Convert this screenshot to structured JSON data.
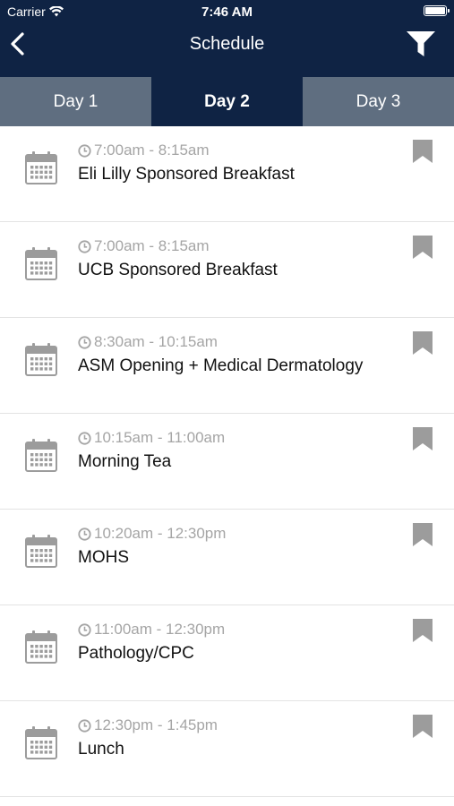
{
  "status_bar": {
    "carrier": "Carrier",
    "time": "7:46 AM"
  },
  "nav": {
    "title": "Schedule",
    "back_icon": "chevron-left-icon",
    "filter_icon": "filter-icon"
  },
  "tabs": [
    {
      "label": "Day 1",
      "active": false
    },
    {
      "label": "Day 2",
      "active": true
    },
    {
      "label": "Day 3",
      "active": false
    }
  ],
  "colors": {
    "header_bg": "#0f2344",
    "tab_inactive_bg": "#5f6e80",
    "time_text": "#a5a5a5",
    "icon_gray": "#9c9c9c"
  },
  "events": [
    {
      "time": "7:00am - 8:15am",
      "title": "Eli Lilly Sponsored Breakfast"
    },
    {
      "time": "7:00am - 8:15am",
      "title": "UCB Sponsored Breakfast"
    },
    {
      "time": "8:30am - 10:15am",
      "title": "ASM Opening + Medical Dermatology"
    },
    {
      "time": "10:15am - 11:00am",
      "title": "Morning Tea"
    },
    {
      "time": "10:20am - 12:30pm",
      "title": "MOHS"
    },
    {
      "time": "11:00am - 12:30pm",
      "title": "Pathology/CPC"
    },
    {
      "time": "12:30pm - 1:45pm",
      "title": "Lunch"
    }
  ]
}
